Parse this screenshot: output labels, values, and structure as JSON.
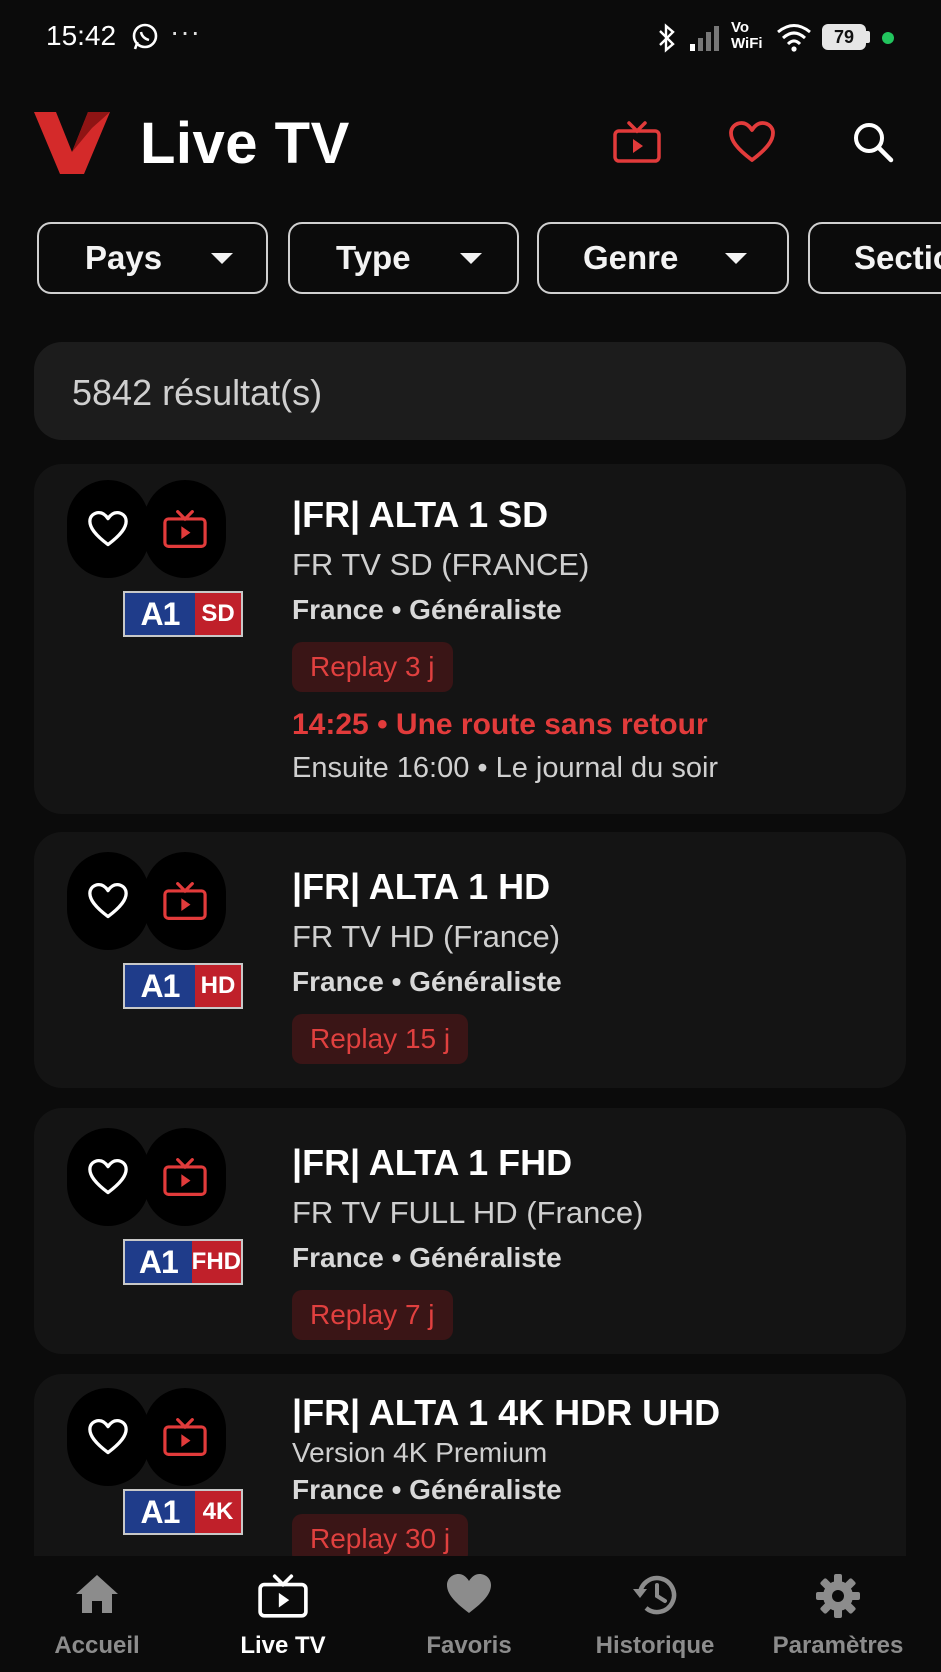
{
  "status_bar": {
    "time": "15:42",
    "dots": "···",
    "vowifi_top": "Vo",
    "vowifi_bottom": "WiFi",
    "battery": "79"
  },
  "header": {
    "title": "Live TV"
  },
  "filters": [
    {
      "label": "Pays"
    },
    {
      "label": "Type"
    },
    {
      "label": "Genre"
    },
    {
      "label": "Section"
    }
  ],
  "results": {
    "count_text": "5842 résultat(s)"
  },
  "channels": [
    {
      "name": "|FR| ALTA 1 SD",
      "group": "FR TV SD (FRANCE)",
      "meta": "France • Généraliste",
      "replay": "Replay 3 j",
      "logo_main": "A1",
      "logo_quality": "SD",
      "now": "14:25 • Une route sans retour",
      "next": "Ensuite 16:00 • Le journal du soir"
    },
    {
      "name": "|FR| ALTA 1 HD",
      "group": "FR TV HD (France)",
      "meta": "France • Généraliste",
      "replay": "Replay 15 j",
      "logo_main": "A1",
      "logo_quality": "HD"
    },
    {
      "name": "|FR| ALTA 1 FHD",
      "group": "FR TV FULL HD (France)",
      "meta": "France • Généraliste",
      "replay": "Replay 7 j",
      "logo_main": "A1",
      "logo_quality": "FHD"
    },
    {
      "name": "|FR| ALTA 1 4K HDR UHD",
      "group": "Version 4K Premium",
      "meta": "France • Généraliste",
      "replay": "Replay 30 j",
      "logo_main": "A1",
      "logo_quality": "4K"
    }
  ],
  "nav": [
    {
      "label": "Accueil",
      "icon": "home-icon"
    },
    {
      "label": "Live TV",
      "icon": "tv-icon"
    },
    {
      "label": "Favoris",
      "icon": "heart-icon"
    },
    {
      "label": "Historique",
      "icon": "history-icon"
    },
    {
      "label": "Paramètres",
      "icon": "gear-icon"
    }
  ],
  "colors": {
    "accent": "#e23b3b",
    "background": "#0b0b0b",
    "card": "#141414",
    "chip_border": "#d0d0d0"
  }
}
